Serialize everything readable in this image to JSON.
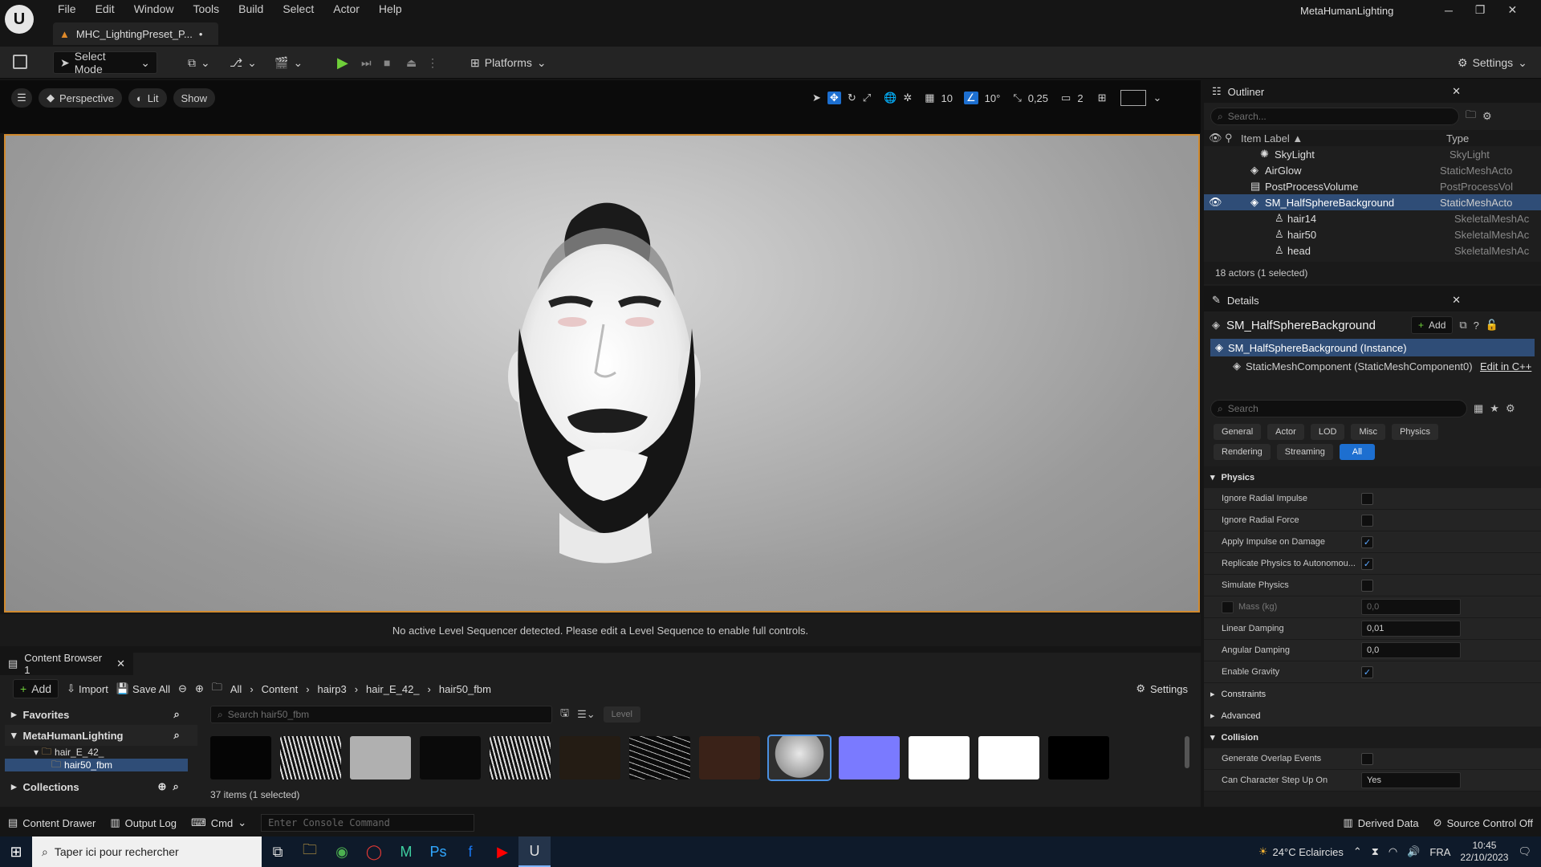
{
  "app": {
    "project_name": "MetaHumanLighting",
    "tab_title": "MHC_LightingPreset_P...",
    "modified_marker": "•"
  },
  "menu": [
    "File",
    "Edit",
    "Window",
    "Tools",
    "Build",
    "Select",
    "Actor",
    "Help"
  ],
  "toolbar": {
    "select_mode": "Select Mode",
    "platforms": "Platforms",
    "settings": "Settings"
  },
  "viewport_bar": {
    "perspective": "Perspective",
    "lit": "Lit",
    "show": "Show",
    "grid_value": "10",
    "angle_value": "10°",
    "scale_value": "0,25",
    "camera_speed": "2"
  },
  "sequencer_message": "No active Level Sequencer detected. Please edit a Level Sequence to enable full controls.",
  "outliner": {
    "title": "Outliner",
    "search_placeholder": "Search...",
    "col_label": "Item Label",
    "col_type": "Type",
    "rows": [
      {
        "label": "SkyLight",
        "type": "SkyLight"
      },
      {
        "label": "AirGlow",
        "type": "StaticMeshActo"
      },
      {
        "label": "PostProcessVolume",
        "type": "PostProcessVol"
      },
      {
        "label": "SM_HalfSphereBackground",
        "type": "StaticMeshActo"
      },
      {
        "label": "hair14",
        "type": "SkeletalMeshAc"
      },
      {
        "label": "hair50",
        "type": "SkeletalMeshAc"
      },
      {
        "label": "head",
        "type": "SkeletalMeshAc"
      }
    ],
    "status": "18 actors (1 selected)"
  },
  "details": {
    "title": "Details",
    "object_name": "SM_HalfSphereBackground",
    "add_label": "Add",
    "instance_label": "SM_HalfSphereBackground (Instance)",
    "component_label": "StaticMeshComponent (StaticMeshComponent0)",
    "edit_cpp": "Edit in C++",
    "search_placeholder": "Search",
    "filters_row1": [
      "General",
      "Actor",
      "LOD",
      "Misc",
      "Physics"
    ],
    "filters_row2": [
      "Rendering",
      "Streaming",
      "All"
    ],
    "physics_section": "Physics",
    "props": [
      {
        "label": "Ignore Radial Impulse",
        "kind": "check",
        "checked": false
      },
      {
        "label": "Ignore Radial Force",
        "kind": "check",
        "checked": false
      },
      {
        "label": "Apply Impulse on Damage",
        "kind": "check",
        "checked": true
      },
      {
        "label": "Replicate Physics to Autonomou...",
        "kind": "check",
        "checked": true
      },
      {
        "label": "Simulate Physics",
        "kind": "check",
        "checked": false
      },
      {
        "label": "Mass (kg)",
        "kind": "number",
        "value": "0,0",
        "disabled": true
      },
      {
        "label": "Linear Damping",
        "kind": "number",
        "value": "0,01"
      },
      {
        "label": "Angular Damping",
        "kind": "number",
        "value": "0,0"
      },
      {
        "label": "Enable Gravity",
        "kind": "check",
        "checked": true
      }
    ],
    "constraints": "Constraints",
    "advanced": "Advanced",
    "collision_section": "Collision",
    "generate_overlap": "Generate Overlap Events",
    "can_step_up": "Can Character Step Up On",
    "can_step_up_value": "Yes"
  },
  "content_browser": {
    "tab": "Content Browser 1",
    "add": "Add",
    "import": "Import",
    "save_all": "Save All",
    "path": [
      "All",
      "Content",
      "hairp3",
      "hair_E_42_",
      "hair50_fbm"
    ],
    "settings": "Settings",
    "favorites": "Favorites",
    "project": "MetaHumanLighting",
    "tree": [
      "hair_E_42_",
      "hair50_fbm"
    ],
    "collections": "Collections",
    "search_placeholder": "Search hair50_fbm",
    "level_filter": "Level",
    "thumbs": [
      "#050505",
      "#e5e5e5",
      "#b0b0b0",
      "#0a0a0a",
      "#e0e0e0",
      "#241c14",
      "#111111",
      "#3a2218",
      "#2f2f2f",
      "#7a7aff",
      "#ffffff",
      "#ffffff",
      "#000000"
    ],
    "item_count": "37 items (1 selected)"
  },
  "statusbar": {
    "content_drawer": "Content Drawer",
    "output_log": "Output Log",
    "cmd": "Cmd",
    "console_placeholder": "Enter Console Command",
    "derived_data": "Derived Data",
    "source_control": "Source Control Off"
  },
  "taskbar": {
    "search_placeholder": "Taper ici pour rechercher",
    "weather": "24°C  Eclaircies",
    "lang": "FRA",
    "time": "10:45",
    "date": "22/10/2023"
  }
}
